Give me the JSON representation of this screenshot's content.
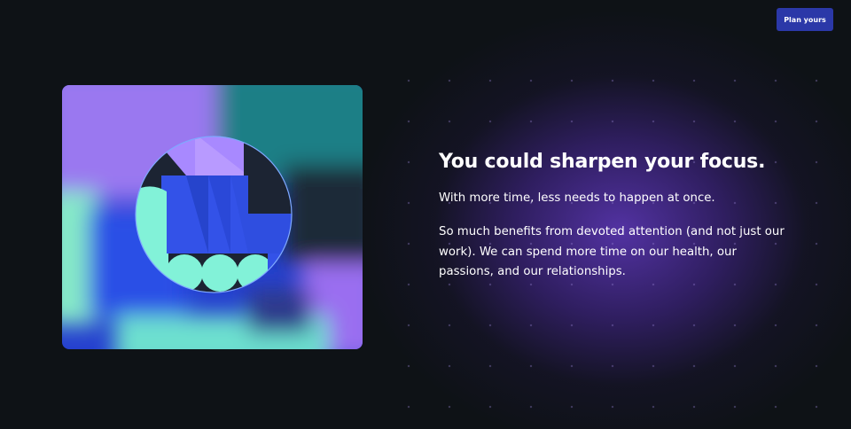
{
  "header": {
    "cta_label": "Plan yours"
  },
  "hero": {
    "illustration_icon": "abstract-geometric-focus-illustration"
  },
  "content": {
    "headline": "You could sharpen your focus.",
    "paragraph_1": "With more time, less needs to happen at once.",
    "paragraph_2": "So much benefits from devoted attention (and not just our work). We can spend more time on our health, our passions, and our relationships."
  },
  "colors": {
    "background": "#0e1216",
    "glow": "#5634aa",
    "button": "#2b38a8",
    "violet": "#9d7cf2",
    "blue": "#2f4ee0",
    "mint": "#7ff0d6",
    "teal": "#1f7f86"
  }
}
